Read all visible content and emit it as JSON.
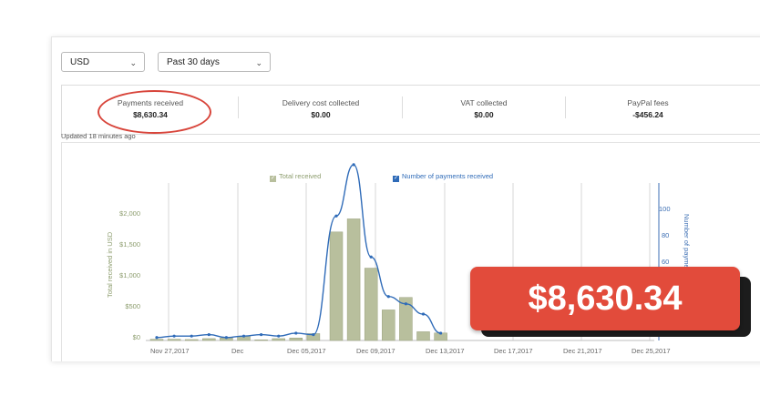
{
  "filters": {
    "currency": "USD",
    "period": "Past 30 days"
  },
  "stats": [
    {
      "label": "Payments received",
      "value": "$8,630.34"
    },
    {
      "label": "Delivery cost collected",
      "value": "$0.00"
    },
    {
      "label": "VAT collected",
      "value": "$0.00"
    },
    {
      "label": "PayPal fees",
      "value": "-$456.24"
    }
  ],
  "updated": "Updated 18 minutes ago",
  "legend": {
    "bars": "Total received",
    "line": "Number of payments received"
  },
  "colors": {
    "bars": "#b8bf9d",
    "line": "#2f6bb8",
    "highlight": "#e24b3b"
  },
  "chart_data": {
    "type": "bar",
    "ylabel": "Total received in USD",
    "y2label": "Number of payments received",
    "ylim": [
      0,
      2000
    ],
    "y2lim": [
      0,
      100
    ],
    "yticks": [
      "$0",
      "$500",
      "$1,000",
      "$1,500",
      "$2,000"
    ],
    "y2ticks": [
      "60",
      "80",
      "100"
    ],
    "xticks": [
      "Nov 27,2017",
      "Dec",
      "Dec 05,2017",
      "Dec 09,2017",
      "Dec 13,2017",
      "Dec 17,2017",
      "Dec 21,2017",
      "Dec 25,2017"
    ],
    "series": [
      {
        "name": "Total received",
        "values": [
          20,
          20,
          15,
          30,
          40,
          70,
          10,
          30,
          40,
          110,
          1740,
          1950,
          1160,
          490,
          690,
          140,
          120
        ]
      },
      {
        "name": "Number of payments received",
        "values": [
          2,
          3,
          3,
          4,
          2,
          3,
          4,
          3,
          5,
          4,
          85,
          120,
          57,
          30,
          25,
          18,
          5
        ]
      }
    ]
  },
  "highlight_value": "$8,630.34"
}
